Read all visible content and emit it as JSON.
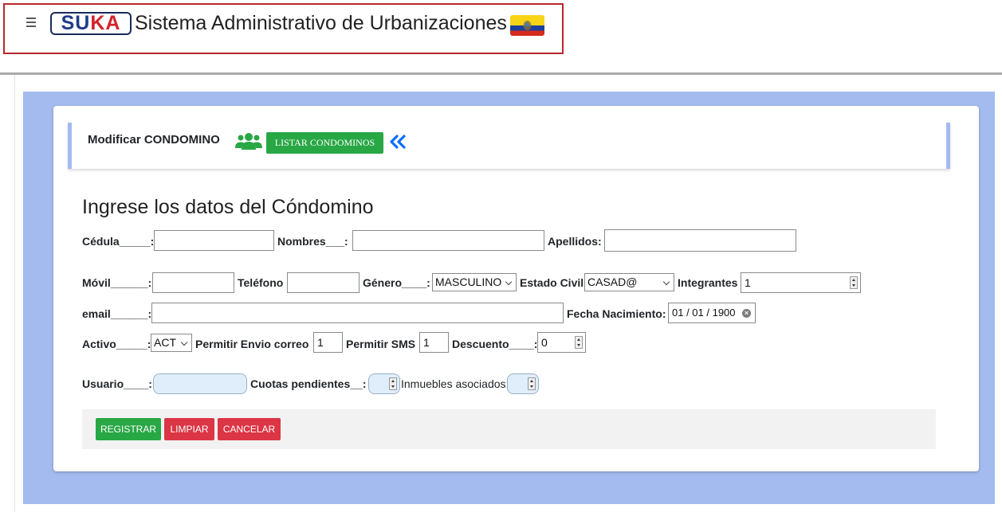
{
  "header": {
    "logo_su": "SU",
    "logo_ka": "KA",
    "title": "Sistema Administrativo de Urbanizaciones"
  },
  "toolbar": {
    "title": "Modificar CONDOMINO",
    "list_button": "LISTAR CONDOMINOS"
  },
  "form": {
    "heading": "Ingrese los datos del Cóndomino",
    "cedula": {
      "label": "Cédula_____:",
      "value": ""
    },
    "nombres": {
      "label": "Nombres___:",
      "value": ""
    },
    "apellidos": {
      "label": "Apellidos:",
      "value": ""
    },
    "movil": {
      "label": "Móvil______:",
      "value": ""
    },
    "telefono": {
      "label": "Teléfono",
      "value": ""
    },
    "genero": {
      "label": "Género____:",
      "value": "MASCULINO"
    },
    "estado_civil": {
      "label": "Estado Civil",
      "value": "CASAD@"
    },
    "integrantes": {
      "label": "Integrantes",
      "value": "1"
    },
    "email": {
      "label": "email______:",
      "value": ""
    },
    "fecha_nacimiento": {
      "label": "Fecha Nacimiento:",
      "value": "01 / 01 / 1900"
    },
    "activo": {
      "label": "Activo_____:",
      "value": "ACT"
    },
    "permitir_envio_correo": {
      "label": "Permitir Envio correo",
      "value": "1"
    },
    "permitir_sms": {
      "label": "Permitir SMS",
      "value": "1"
    },
    "descuento": {
      "label": "Descuento____:",
      "value": "0"
    },
    "usuario": {
      "label": "Usuario____:",
      "value": ""
    },
    "cuotas_pendientes": {
      "label": "Cuotas pendientes__:",
      "value": ""
    },
    "inmuebles_asociados": {
      "label": "Inmuebles asociados:",
      "value": ""
    }
  },
  "buttons": {
    "registrar": "REGISTRAR",
    "limpiar": "LIMPIAR",
    "cancelar": "CANCELAR"
  },
  "colors": {
    "header_border": "#b8282e",
    "frame_blue": "#a3bbee",
    "success": "#28a745",
    "danger": "#dc3545",
    "link_blue": "#0d6efd"
  },
  "icons": {
    "menu": "hamburger-icon",
    "users": "users-icon",
    "back": "double-chevron-left-icon",
    "flag": "ecuador-flag"
  }
}
